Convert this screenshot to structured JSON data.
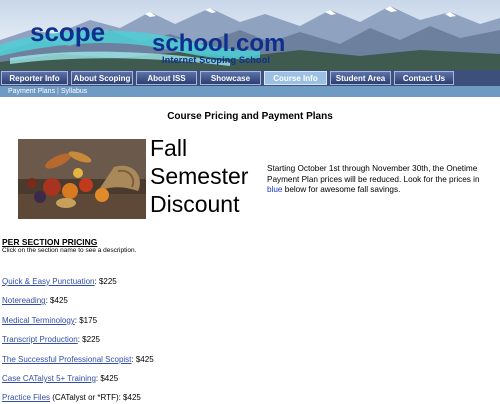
{
  "header": {
    "logo_scope": "scope",
    "logo_school": "school.com",
    "tagline": "Internet Scoping School"
  },
  "nav": {
    "items": [
      {
        "label": "Reporter Info"
      },
      {
        "label": "About Scoping"
      },
      {
        "label": "About ISS"
      },
      {
        "label": "Showcase"
      },
      {
        "label": "Course Info",
        "active": true
      },
      {
        "label": "Student Area"
      },
      {
        "label": "Contact Us"
      }
    ]
  },
  "subnav": {
    "payment_plans": "Payment Plans",
    "separator": "|",
    "syllabus": "Syllabus"
  },
  "main": {
    "title": "Course Pricing and Payment Plans",
    "promo": {
      "line1": "Fall",
      "line2": "Semester",
      "line3": "Discount",
      "text_before_blue": "Starting October 1st through November 30th, the Onetime Payment Plan prices will be reduced.  Look for the prices in ",
      "blue_word": "blue",
      "text_after_blue": " below for awesome fall savings."
    },
    "section_heading": "PER SECTION PRICING",
    "section_hint": "Click on the section name to see a description.",
    "items": [
      {
        "name": "Quick & Easy Punctuation",
        "suffix": ": $225"
      },
      {
        "name": "Notereading",
        "suffix": ": $425"
      },
      {
        "name": "Medical Terminology",
        "suffix": ": $175"
      },
      {
        "name": "Transcript Production",
        "suffix": ": $225"
      },
      {
        "name": "The Successful Professional Scopist",
        "suffix": ": $425"
      },
      {
        "name": "Case CATalyst 5+ Training",
        "suffix": ":  $425"
      },
      {
        "name": "Practice Files",
        "suffix": " (CATalyst or *RTF): $425"
      }
    ]
  },
  "colors": {
    "logo_blue": "#0e2f8e",
    "nav_bg": "#3d4f7a",
    "nav_active": "#9cc0e4",
    "subnav_bg": "#6f9ac3",
    "link": "#334ea6",
    "promo_blue": "#1b37c7"
  }
}
